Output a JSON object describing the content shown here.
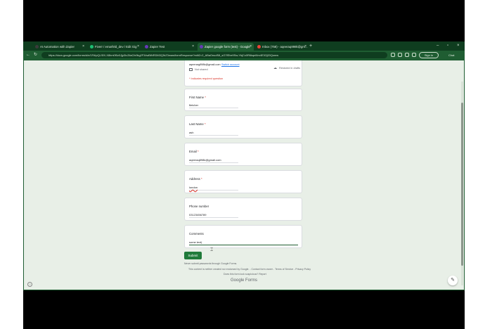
{
  "tabs": [
    {
      "label": "AI Automation with Zapier",
      "fav": "#3b3b3b"
    },
    {
      "label": "Fiverr / emarfeld_dev / Edit Gig",
      "fav": "#1dbf73"
    },
    {
      "label": "Zapier Test",
      "fav": "#673ab7"
    },
    {
      "label": "Zapier google form (test) - Google",
      "fav": "#673ab7"
    },
    {
      "label": "Inbox (758) - aqeeraq898k@gm...",
      "fav": "#ea4335"
    }
  ],
  "url": "https://docs.google.com/forms/d/e/1FAIpQLSfX-X8hm0f0z0Jjp3Ic2IiaCfx9kg2F34wBtNRDM3Q5rZ3maw/formResponse?edit2=2_ABaOnudS8_sG7fEhe9Sw-YbjCc0R6kqnI6m4E3Oj20Qomw",
  "browser": {
    "signin": "Sign in",
    "chat": "Chat",
    "newtab": "+"
  },
  "form": {
    "account_email": "aqeerarg898k@gmail.com",
    "switch_account": "Switch account",
    "not_shared": "Not shared",
    "draft_status": "Restored in drafts",
    "required_note": "* Indicates required question",
    "questions": [
      {
        "label": "First Name",
        "required": "*",
        "value": "fletcher"
      },
      {
        "label": "Last Name",
        "required": "*",
        "value": "ash"
      },
      {
        "label": "Email",
        "required": "*",
        "value": "aqeeraq898k@gmail.com"
      },
      {
        "label": "Address",
        "required": "*",
        "value": "london"
      },
      {
        "label": "Phone number",
        "required": "",
        "value": "03123456789"
      },
      {
        "label": "Comments",
        "required": "",
        "value": "some text|"
      }
    ],
    "submit": "Submit",
    "footer_note": "Never submit passwords through Google Forms.",
    "footer_disclaimer": "This content is neither created nor endorsed by Google. - Contact form owner - Terms of Service - Privacy Policy",
    "footer_report": "Does this form look suspicious? Report",
    "logo": "Google Forms"
  },
  "colors": {
    "accent": "#1f5d32",
    "tabbar": "#0f3d1f",
    "page_bg": "#e8efe7",
    "required": "#d93025"
  }
}
